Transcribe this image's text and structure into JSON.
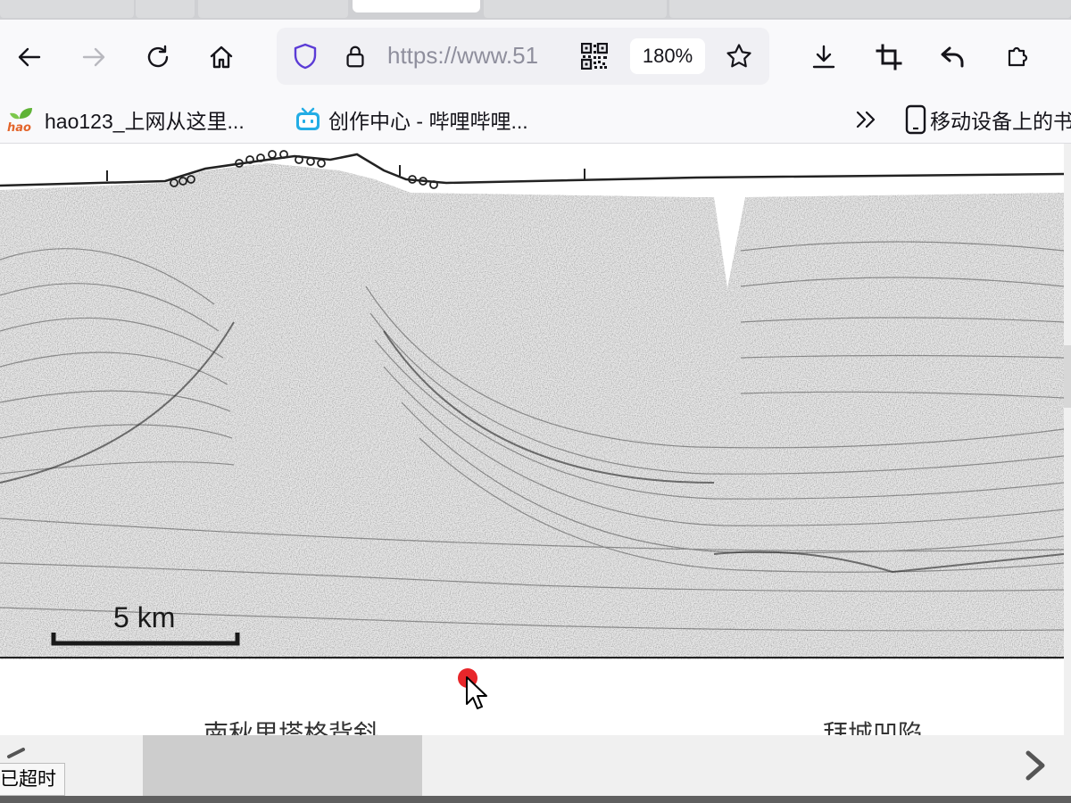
{
  "browser": {
    "address_bar": {
      "url_text": "https://www.51",
      "zoom": "180%"
    },
    "toolbar_icons": [
      "back-icon",
      "forward-icon",
      "reload-icon",
      "home-icon",
      "shield-icon",
      "lock-icon",
      "qr-code-icon",
      "star-icon",
      "download-icon",
      "crop-icon",
      "undo-icon",
      "extensions-icon"
    ],
    "colors": {
      "toolbar_bg": "#f9f9fb",
      "shield": "#5b3bd6",
      "accent_red": "#e8262a"
    }
  },
  "bookmarks": {
    "items": [
      {
        "label": "hao123_上网从这里..."
      },
      {
        "label": "创作中心 - 哔哩哔哩..."
      }
    ],
    "overflow_icon": "chevrons-right-icon",
    "mobile_label": "移动设备上的书"
  },
  "content": {
    "scale_label": "5 km",
    "caption_left": "南秋里塔格背斜",
    "caption_right": "拜城凹陷"
  },
  "status": {
    "text": "已超时"
  }
}
